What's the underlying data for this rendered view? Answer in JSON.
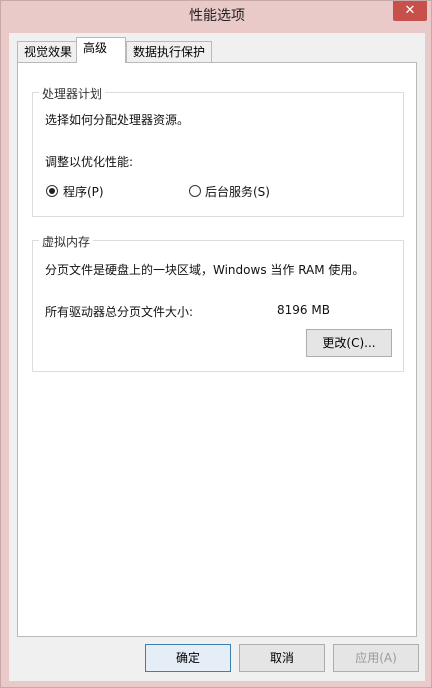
{
  "window": {
    "title": "性能选项",
    "close_glyph": "✕"
  },
  "tabs": [
    {
      "label": "视觉效果"
    },
    {
      "label": "高级"
    },
    {
      "label": "数据执行保护"
    }
  ],
  "processor_group": {
    "title": "处理器计划",
    "description": "选择如何分配处理器资源。",
    "adjust_label": "调整以优化性能:",
    "options": [
      {
        "label": "程序(P)",
        "selected": true
      },
      {
        "label": "后台服务(S)",
        "selected": false
      }
    ]
  },
  "memory_group": {
    "title": "虚拟内存",
    "description": "分页文件是硬盘上的一块区域，Windows 当作 RAM 使用。",
    "total_label": "所有驱动器总分页文件大小:",
    "total_value": "8196 MB",
    "change_button": "更改(C)..."
  },
  "footer": {
    "ok": "确定",
    "cancel": "取消",
    "apply": "应用(A)"
  }
}
